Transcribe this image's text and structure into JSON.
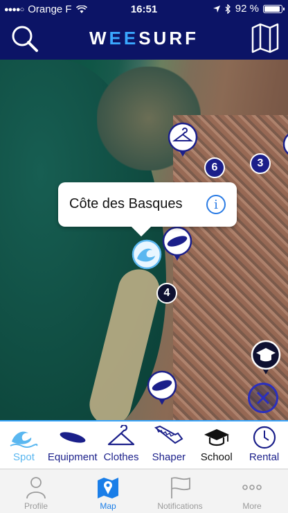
{
  "status_bar": {
    "signal": "●●●●○",
    "carrier": "Orange F",
    "time": "16:51",
    "battery": "92 %"
  },
  "header": {
    "logo_prefix": "W",
    "logo_accent": "EE",
    "logo_suffix": "SURF"
  },
  "map": {
    "callout": {
      "title": "Côte des Basques"
    },
    "badges": [
      "6",
      "3",
      "4"
    ]
  },
  "categories": [
    {
      "label": "Spot",
      "icon": "wave-icon",
      "active": true
    },
    {
      "label": "Equipment",
      "icon": "surfboard-icon"
    },
    {
      "label": "Clothes",
      "icon": "hanger-icon"
    },
    {
      "label": "Shaper",
      "icon": "saw-icon"
    },
    {
      "label": "School",
      "icon": "graduation-cap-icon"
    },
    {
      "label": "Rental",
      "icon": "clock-icon"
    }
  ],
  "tabs": [
    {
      "label": "Profile",
      "icon": "person-icon"
    },
    {
      "label": "Map",
      "icon": "map-pin-icon",
      "active": true
    },
    {
      "label": "Notifications",
      "icon": "flag-icon"
    },
    {
      "label": "More",
      "icon": "more-icon"
    }
  ],
  "colors": {
    "header_bg": "#0c1466",
    "accent": "#3aa8ff",
    "pin_blue": "#1b1f8a",
    "active_tab": "#1a7ee8"
  }
}
